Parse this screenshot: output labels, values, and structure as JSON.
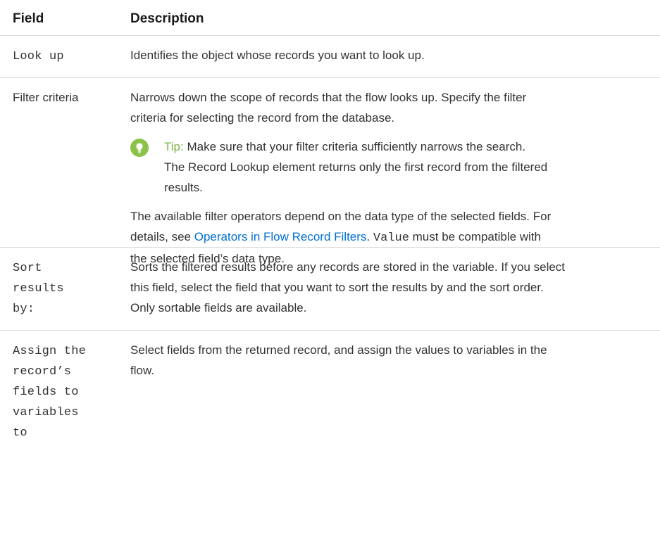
{
  "header": {
    "field": "Field",
    "description": "Description"
  },
  "rows": [
    {
      "field": "Look up",
      "description": "Identifies the object whose records you want to look up."
    },
    {
      "field": "Filter criteria",
      "description_line1": "Narrows down the scope of records that the flow looks up. Specify the filter",
      "description_line2": "criteria for selecting the record from the database.",
      "tip": {
        "icon": "lightbulb-icon",
        "label": "Tip:",
        "line1": "Make sure that your filter criteria sufficiently narrows the search.",
        "line2": "The Record Lookup element returns only the first record from the filtered",
        "line3": "results."
      },
      "operators": {
        "line1": "The available filter operators depend on the data type of the selected fields. For",
        "line2_before": "details, see",
        "link": "Operators in Flow Record Filters",
        "line2_after": ".",
        "code": "Value",
        "line2_tail": "must be compatible with",
        "line3": "the selected field’s data type."
      }
    },
    {
      "field_lines": [
        "Sort",
        "results",
        "by:"
      ],
      "description_lines": [
        "Sorts the filtered results before any records are stored in the variable. If you select",
        "this field, select the field that you want to sort the results by and the sort order.",
        "Only sortable fields are available."
      ]
    },
    {
      "field_lines": [
        "Assign the",
        "record’s",
        "fields to",
        "variables",
        "to"
      ],
      "description_lines": [
        "Select fields from the returned record, and assign the values to variables in the",
        "flow."
      ]
    }
  ],
  "colors": {
    "link": "#0070d2",
    "tip_accent": "#7cb342",
    "divider": "#d9d9d9"
  }
}
